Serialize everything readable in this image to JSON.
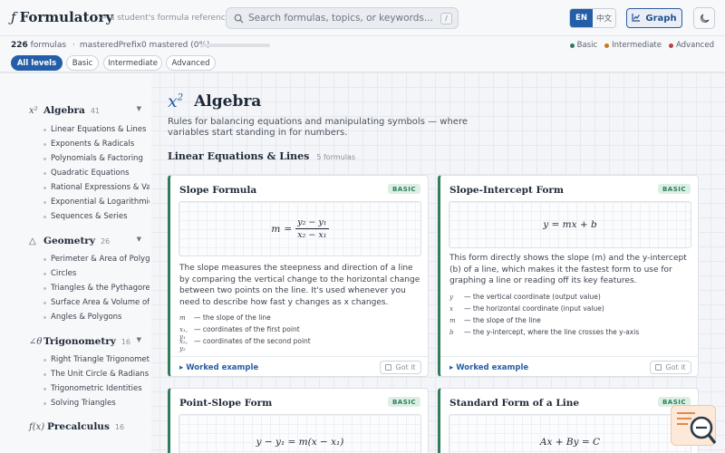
{
  "app": {
    "logo_glyph": "ƒ",
    "name": "Formulatory",
    "tagline": "— a student's formula reference"
  },
  "search": {
    "placeholder": "Search formulas, topics, or keywords...",
    "shortcut": "/"
  },
  "language": {
    "active": "EN",
    "other": "中文"
  },
  "graph_label": "Graph",
  "theme_icon": "moon-icon",
  "status": {
    "count": "226",
    "count_label": "formulas",
    "separator": "·",
    "mastered_text": "masteredPrefix0 mastered (0%)",
    "mastered_fraction": 0
  },
  "legend": [
    {
      "label": "Basic",
      "color": "#2f7d5b"
    },
    {
      "label": "Intermediate",
      "color": "#c47a1d"
    },
    {
      "label": "Advanced",
      "color": "#b54545"
    }
  ],
  "filters": [
    "All levels",
    "Basic",
    "Intermediate",
    "Advanced"
  ],
  "sidebar": {
    "categories": [
      {
        "icon": "x²",
        "title": "Algebra",
        "count": "41",
        "items": [
          "Linear Equations & Lines",
          "Exponents & Radicals",
          "Polynomials & Factoring",
          "Quadratic Equations",
          "Rational Expressions & Variation",
          "Exponential & Logarithmic",
          "Sequences & Series"
        ]
      },
      {
        "icon": "△",
        "title": "Geometry",
        "count": "26",
        "items": [
          "Perimeter & Area of Polygons",
          "Circles",
          "Triangles & the Pythagorean",
          "Surface Area & Volume of Solids",
          "Angles & Polygons"
        ]
      },
      {
        "icon": "∠θ",
        "title": "Trigonometry",
        "count": "16",
        "items": [
          "Right Triangle Trigonometry",
          "The Unit Circle & Radians",
          "Trigonometric Identities",
          "Solving Triangles"
        ]
      },
      {
        "icon": "f(x)",
        "title": "Precalculus",
        "count": "16",
        "items": []
      }
    ]
  },
  "page": {
    "icon": "x",
    "icon_sup": "2",
    "title": "Algebra",
    "description": "Rules for balancing equations and manipulating symbols — where variables start standing in for numbers.",
    "section_title": "Linear Equations & Lines",
    "section_count": "5 formulas"
  },
  "cards": [
    {
      "title": "Slope Formula",
      "badge": "BASIC",
      "formula": {
        "lhs": "m",
        "eq": "=",
        "num": "y₂ − y₁",
        "den": "x₂ − x₁"
      },
      "description": "The slope measures the steepness and direction of a line by comparing the vertical change to the horizontal change between two points on the line. It's used whenever you need to describe how fast y changes as x changes.",
      "vars": [
        {
          "sym": "m",
          "text": "— the slope of the line"
        },
        {
          "sym": "x₁, y₁",
          "text": "— coordinates of the first point"
        },
        {
          "sym": "x₂, y₂",
          "text": "— coordinates of the second point"
        }
      ],
      "worked": "▸ Worked example",
      "got_it": "Got it"
    },
    {
      "title": "Slope-Intercept Form",
      "badge": "BASIC",
      "formula": {
        "text": "y = mx + b"
      },
      "description": "This form directly shows the slope (m) and the y-intercept (b) of a line, which makes it the fastest form to use for graphing a line or reading off its key features.",
      "vars": [
        {
          "sym": "y",
          "text": "— the vertical coordinate (output value)"
        },
        {
          "sym": "x",
          "text": "— the horizontal coordinate (input value)"
        },
        {
          "sym": "m",
          "text": "— the slope of the line"
        },
        {
          "sym": "b",
          "text": "— the y-intercept, where the line crosses the y-axis"
        }
      ],
      "worked": "▸ Worked example",
      "got_it": "Got it"
    },
    {
      "title": "Point-Slope Form",
      "badge": "BASIC",
      "formula": {
        "text": "y − y₁ = m(x − x₁)"
      }
    },
    {
      "title": "Standard Form of a Line",
      "badge": "BASIC",
      "formula": {
        "text": "Ax + By = C"
      }
    }
  ]
}
